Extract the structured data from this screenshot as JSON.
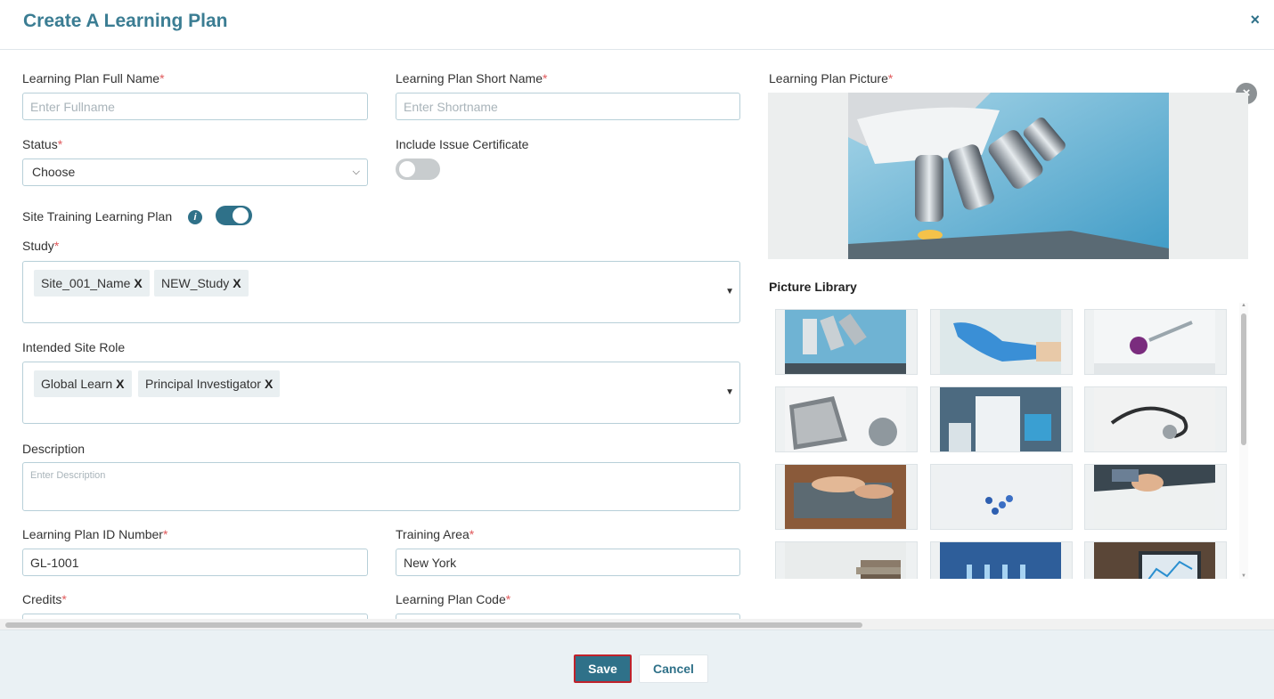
{
  "dialog": {
    "title": "Create A Learning Plan",
    "close": "×"
  },
  "form": {
    "full_name": {
      "label": "Learning Plan Full Name",
      "placeholder": "Enter Fullname",
      "value": ""
    },
    "short_name": {
      "label": "Learning Plan Short Name",
      "placeholder": "Enter Shortname",
      "value": ""
    },
    "status": {
      "label": "Status",
      "value": "Choose"
    },
    "issue_certificate": {
      "label": "Include Issue Certificate",
      "on": false
    },
    "site_training": {
      "label": "Site Training Learning Plan",
      "on": true
    },
    "study": {
      "label": "Study",
      "tags": [
        "Site_001_Name",
        "NEW_Study"
      ]
    },
    "site_role": {
      "label": "Intended Site Role",
      "tags": [
        "Global Learn",
        "Principal Investigator"
      ]
    },
    "description": {
      "label": "Description",
      "placeholder": "Enter Description"
    },
    "id_number": {
      "label": "Learning Plan ID Number",
      "value": "GL-1001"
    },
    "training_area": {
      "label": "Training Area",
      "value": "New York"
    },
    "credits": {
      "label": "Credits"
    },
    "plan_code": {
      "label": "Learning Plan Code"
    },
    "required_mark": "*",
    "tag_remove": "X"
  },
  "picture": {
    "label": "Learning Plan Picture",
    "clear": "×",
    "library_title": "Picture Library",
    "library": [
      "microscope",
      "gloved-hand",
      "syringe-virus",
      "laptop-desk",
      "lab-scientist",
      "stethoscope",
      "typing-laptop",
      "blue-pills",
      "signing-document",
      "books",
      "test-tubes",
      "laptop-chart"
    ]
  },
  "footer": {
    "save": "Save",
    "cancel": "Cancel"
  },
  "colors": {
    "accent": "#2f7189",
    "title": "#3b7d93",
    "required": "#e0595b",
    "save_outline": "#c0222b"
  }
}
